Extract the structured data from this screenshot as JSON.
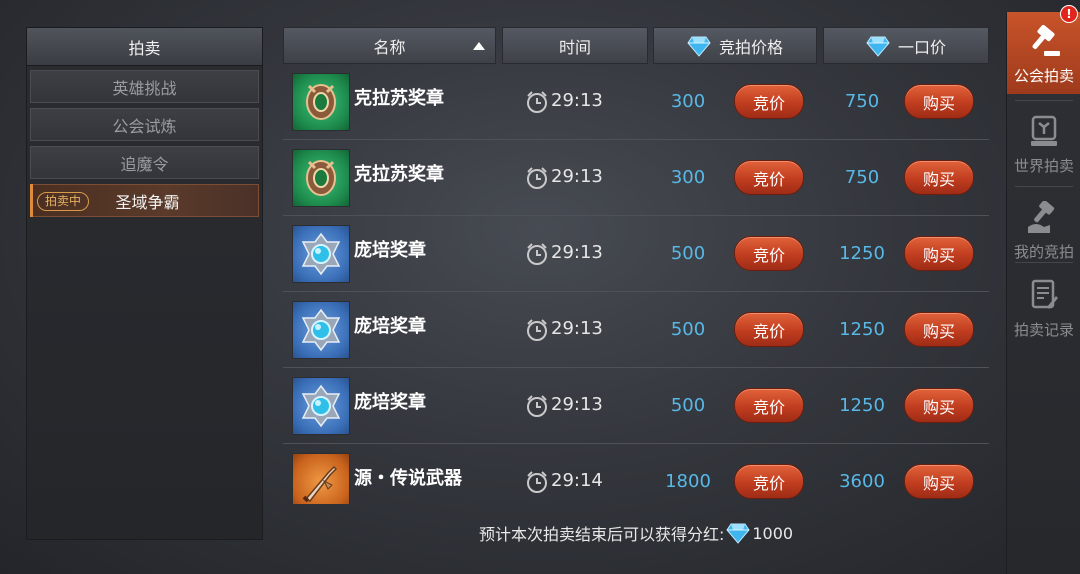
{
  "left_panel": {
    "title": "拍卖",
    "categories": [
      {
        "label": "英雄挑战"
      },
      {
        "label": "公会试炼"
      },
      {
        "label": "追魔令"
      },
      {
        "label": "圣域争霸",
        "badge": "拍卖中"
      }
    ]
  },
  "table": {
    "headers": {
      "name": "名称",
      "time": "时间",
      "bid_price": "竞拍价格",
      "buyout_price": "一口价"
    },
    "bid_button": "竞价",
    "buy_button": "购买",
    "rows": [
      {
        "name": "克拉苏奖章",
        "time": "29:13",
        "bid": "300",
        "buyout": "750",
        "icon": "green-medal-icon"
      },
      {
        "name": "克拉苏奖章",
        "time": "29:13",
        "bid": "300",
        "buyout": "750",
        "icon": "green-medal-icon"
      },
      {
        "name": "庞培奖章",
        "time": "29:13",
        "bid": "500",
        "buyout": "1250",
        "icon": "blue-medal-icon"
      },
      {
        "name": "庞培奖章",
        "time": "29:13",
        "bid": "500",
        "buyout": "1250",
        "icon": "blue-medal-icon"
      },
      {
        "name": "庞培奖章",
        "time": "29:13",
        "bid": "500",
        "buyout": "1250",
        "icon": "blue-medal-icon"
      },
      {
        "name": "源・传说武器",
        "time": "29:14",
        "bid": "1800",
        "buyout": "3600",
        "icon": "legendary-weapon-icon"
      }
    ]
  },
  "footer": {
    "dividend_text": "预计本次拍卖结束后可以获得分红:",
    "dividend_amount": "1000"
  },
  "side_tabs": [
    {
      "label": "公会拍卖",
      "icon": "gavel-icon",
      "active": true,
      "badge": "!"
    },
    {
      "label": "世界拍卖",
      "icon": "world-auction-icon"
    },
    {
      "label": "我的竞拍",
      "icon": "my-bid-icon"
    },
    {
      "label": "拍卖记录",
      "icon": "record-icon"
    }
  ],
  "colors": {
    "price": "#58b8e6",
    "button": "#c13d1f",
    "active_tab": "#c8542a",
    "badge_border": "#d89a48"
  }
}
